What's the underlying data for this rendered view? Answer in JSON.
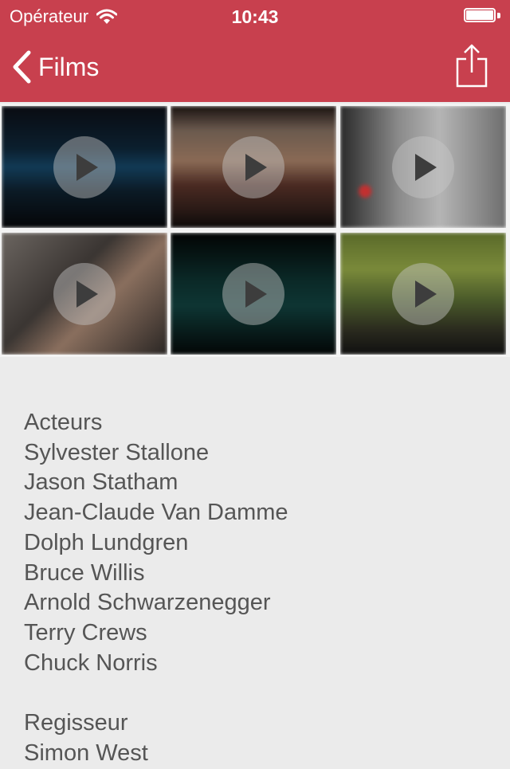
{
  "status_bar": {
    "carrier": "Opérateur",
    "time": "10:43"
  },
  "nav": {
    "back_label": "Films",
    "back_icon": "chevron-left-icon",
    "share_icon": "share-icon"
  },
  "colors": {
    "header": "#c8404e",
    "background": "#ebebeb",
    "text": "#555555"
  },
  "videos": [
    {
      "label": "video-1",
      "play_icon": "play-icon"
    },
    {
      "label": "video-2",
      "play_icon": "play-icon"
    },
    {
      "label": "video-3",
      "play_icon": "play-icon"
    },
    {
      "label": "video-4",
      "play_icon": "play-icon"
    },
    {
      "label": "video-5",
      "play_icon": "play-icon"
    },
    {
      "label": "video-6",
      "play_icon": "play-icon"
    }
  ],
  "details": {
    "actors_heading": "Acteurs",
    "actors": [
      "Sylvester Stallone",
      "Jason Statham",
      "Jean-Claude Van Damme",
      "Dolph Lundgren",
      "Bruce Willis",
      "Arnold Schwarzenegger",
      "Terry Crews",
      "Chuck Norris"
    ],
    "director_heading": "Regisseur",
    "directors": [
      "Simon West"
    ]
  }
}
